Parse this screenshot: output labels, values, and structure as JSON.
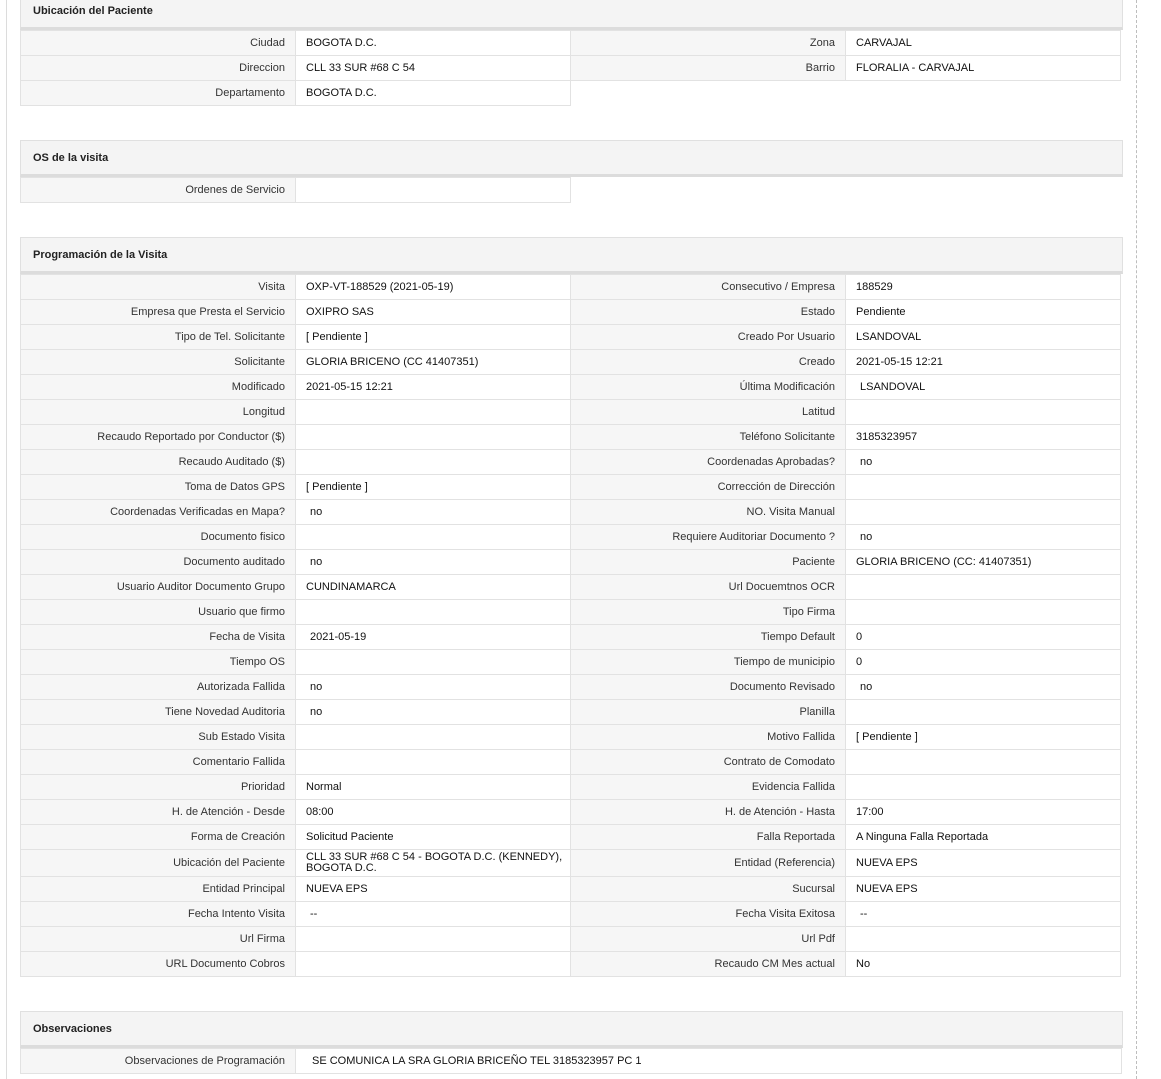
{
  "ubicacion": {
    "title": "Ubicación del Paciente",
    "rows": [
      [
        {
          "label": "Ciudad",
          "value": "BOGOTA D.C."
        },
        {
          "label": "Zona",
          "value": "CARVAJAL"
        }
      ],
      [
        {
          "label": "Direccion",
          "value": "CLL 33 SUR #68 C 54"
        },
        {
          "label": "Barrio",
          "value": "FLORALIA - CARVAJAL"
        }
      ],
      [
        {
          "label": "Departamento",
          "value": "BOGOTA D.C."
        }
      ]
    ]
  },
  "os_visita": {
    "title": "OS de la visita",
    "rows": [
      [
        {
          "label": "Ordenes de Servicio",
          "value": ""
        }
      ]
    ]
  },
  "programacion": {
    "title": "Programación de la Visita",
    "rows": [
      [
        {
          "label": "Visita",
          "value": "OXP-VT-188529 (2021-05-19)"
        },
        {
          "label": "Consecutivo / Empresa",
          "value": "188529"
        }
      ],
      [
        {
          "label": "Empresa que Presta el Servicio",
          "value": "OXIPRO SAS"
        },
        {
          "label": "Estado",
          "value": "Pendiente"
        }
      ],
      [
        {
          "label": "Tipo de Tel. Solicitante",
          "value": "[ Pendiente ]"
        },
        {
          "label": "Creado Por Usuario",
          "value": "LSANDOVAL"
        }
      ],
      [
        {
          "label": "Solicitante",
          "value": "GLORIA BRICENO (CC 41407351)"
        },
        {
          "label": "Creado",
          "value": "2021-05-15 12:21"
        }
      ],
      [
        {
          "label": "Modificado",
          "value": "2021-05-15 12:21"
        },
        {
          "label": "Última Modificación",
          "value": "LSANDOVAL"
        }
      ],
      [
        {
          "label": "Longitud",
          "value": ""
        },
        {
          "label": "Latitud",
          "value": ""
        }
      ],
      [
        {
          "label": "Recaudo Reportado por Conductor ($)",
          "value": ""
        },
        {
          "label": "Teléfono Solicitante",
          "value": "3185323957"
        }
      ],
      [
        {
          "label": "Recaudo Auditado ($)",
          "value": ""
        },
        {
          "label": "Coordenadas Aprobadas?",
          "value": "no"
        }
      ],
      [
        {
          "label": "Toma de Datos GPS",
          "value": "[ Pendiente ]"
        },
        {
          "label": "Corrección de Dirección",
          "value": ""
        }
      ],
      [
        {
          "label": "Coordenadas Verificadas en Mapa?",
          "value": "no"
        },
        {
          "label": "NO. Visita Manual",
          "value": ""
        }
      ],
      [
        {
          "label": "Documento fisico",
          "value": ""
        },
        {
          "label": "Requiere Auditoriar Documento ?",
          "value": "no"
        }
      ],
      [
        {
          "label": "Documento auditado",
          "value": "no"
        },
        {
          "label": "Paciente",
          "value": "GLORIA BRICENO (CC: 41407351)"
        }
      ],
      [
        {
          "label": "Usuario Auditor Documento Grupo",
          "value": "CUNDINAMARCA"
        },
        {
          "label": "Url Docuemtnos OCR",
          "value": ""
        }
      ],
      [
        {
          "label": "Usuario que firmo",
          "value": ""
        },
        {
          "label": "Tipo Firma",
          "value": ""
        }
      ],
      [
        {
          "label": "Fecha de Visita",
          "value": "2021-05-19"
        },
        {
          "label": "Tiempo Default",
          "value": "0"
        }
      ],
      [
        {
          "label": "Tiempo OS",
          "value": ""
        },
        {
          "label": "Tiempo de municipio",
          "value": "0"
        }
      ],
      [
        {
          "label": "Autorizada Fallida",
          "value": "no"
        },
        {
          "label": "Documento Revisado",
          "value": "no"
        }
      ],
      [
        {
          "label": "Tiene Novedad Auditoria",
          "value": "no"
        },
        {
          "label": "Planilla",
          "value": ""
        }
      ],
      [
        {
          "label": "Sub Estado Visita",
          "value": ""
        },
        {
          "label": "Motivo Fallida",
          "value": "[ Pendiente ]"
        }
      ],
      [
        {
          "label": "Comentario Fallida",
          "value": ""
        },
        {
          "label": "Contrato de Comodato",
          "value": ""
        }
      ],
      [
        {
          "label": "Prioridad",
          "value": "Normal"
        },
        {
          "label": "Evidencia Fallida",
          "value": ""
        }
      ],
      [
        {
          "label": "H. de Atención - Desde",
          "value": "08:00"
        },
        {
          "label": "H. de Atención - Hasta",
          "value": "17:00"
        }
      ],
      [
        {
          "label": "Forma de Creación",
          "value": "Solicitud Paciente"
        },
        {
          "label": "Falla Reportada",
          "value": "A Ninguna Falla Reportada"
        }
      ],
      [
        {
          "label": "Ubicación del Paciente",
          "value": "CLL 33 SUR #68 C 54 - BOGOTA D.C. (KENNEDY), BOGOTA D.C."
        },
        {
          "label": "Entidad (Referencia)",
          "value": "NUEVA EPS"
        }
      ],
      [
        {
          "label": "Entidad Principal",
          "value": "NUEVA EPS"
        },
        {
          "label": "Sucursal",
          "value": "NUEVA EPS"
        }
      ],
      [
        {
          "label": "Fecha Intento Visita",
          "value": "--"
        },
        {
          "label": "Fecha Visita Exitosa",
          "value": "--"
        }
      ],
      [
        {
          "label": "Url Firma",
          "value": ""
        },
        {
          "label": "Url Pdf",
          "value": ""
        }
      ],
      [
        {
          "label": "URL Documento Cobros",
          "value": ""
        },
        {
          "label": "Recaudo CM Mes actual",
          "value": "No"
        }
      ]
    ]
  },
  "observaciones": {
    "title": "Observaciones",
    "rows": [
      [
        {
          "label": "Observaciones de Programación",
          "value": "SE COMUNICA LA SRA GLORIA BRICEÑO TEL 3185323957 PC 1"
        }
      ]
    ]
  }
}
